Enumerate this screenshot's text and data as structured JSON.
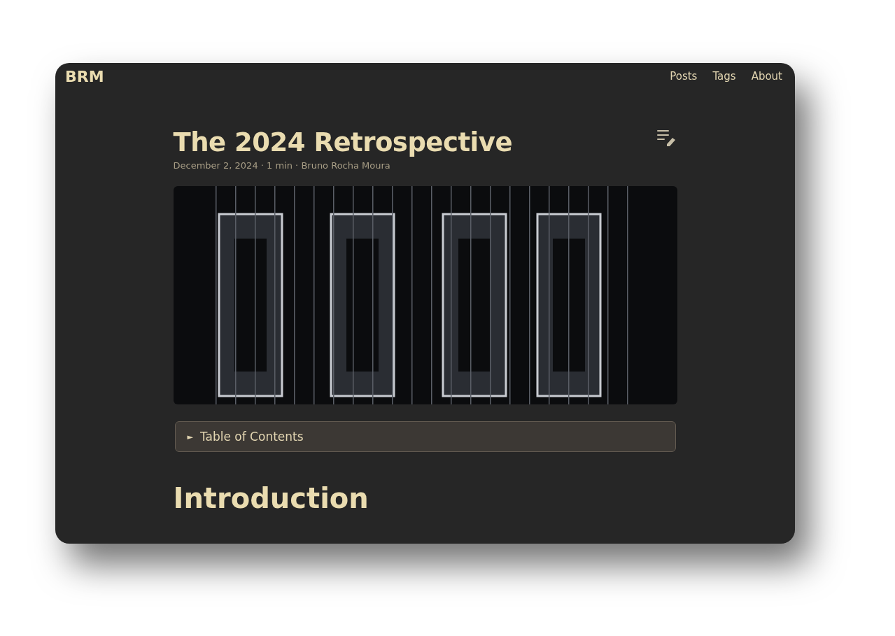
{
  "header": {
    "logo": "BRM",
    "nav": [
      {
        "label": "Posts"
      },
      {
        "label": "Tags"
      },
      {
        "label": "About"
      }
    ]
  },
  "post": {
    "title": "The 2024 Retrospective",
    "meta": "December 2, 2024 · 1 min · Bruno Rocha Moura",
    "toc": {
      "marker": "►",
      "label": "Table of Contents",
      "expanded": false
    },
    "heading": "Introduction"
  }
}
